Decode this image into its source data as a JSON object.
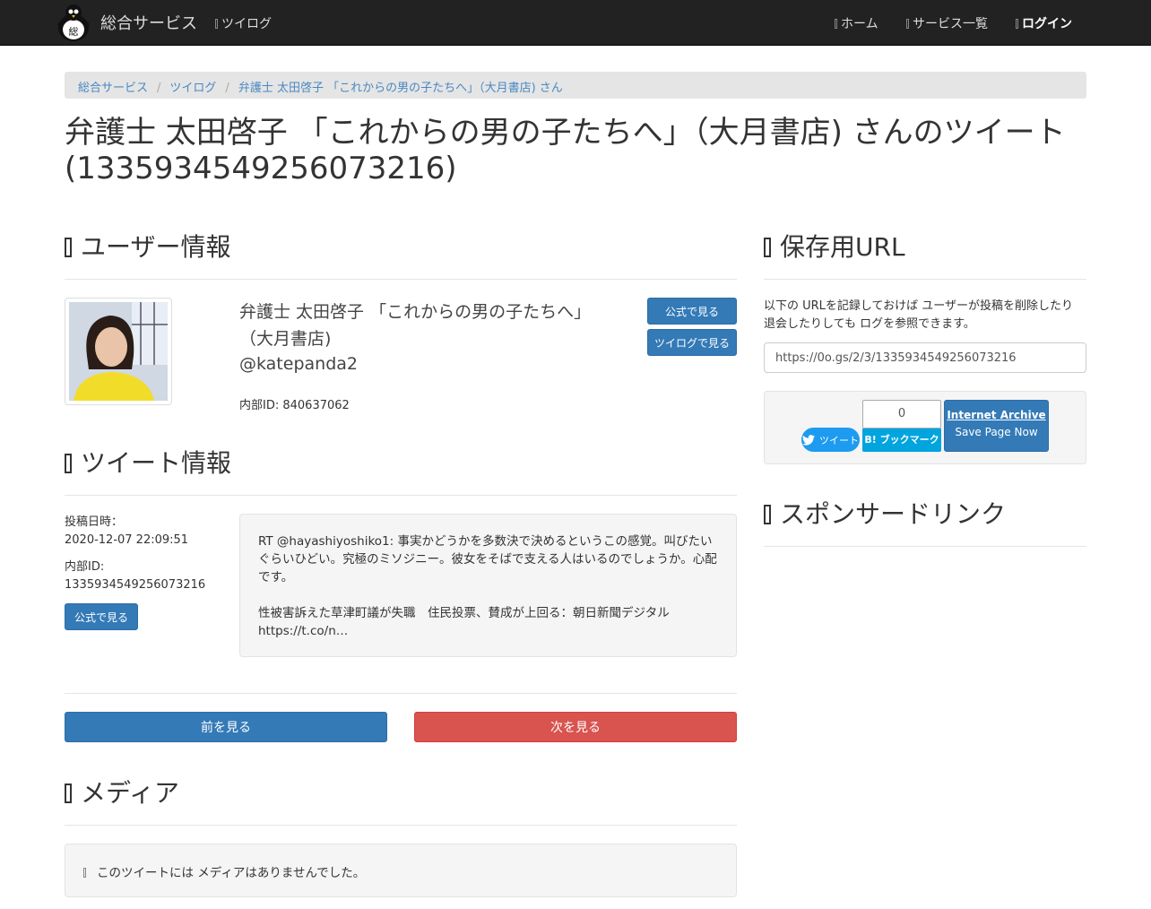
{
  "nav": {
    "brand": "総合サービス",
    "logo_char": "総",
    "left_link": "ツイログ",
    "home": "ホーム",
    "services": "サービス一覧",
    "login": "ログイン"
  },
  "breadcrumb": [
    "総合サービス",
    "ツイログ",
    "弁護士 太田啓子 「これからの男の子たちへ」（大月書店) さん"
  ],
  "page_title": "弁護士 太田啓子 「これからの男の子たちへ」（大月書店) さんのツイート (1335934549256073216)",
  "user_section": {
    "title": "ユーザー情報",
    "display_name": "弁護士 太田啓子 「これからの男の子たちへ」（大月書店)",
    "handle": "@katepanda2",
    "internal_id": "内部ID: 840637062",
    "btn_official": "公式で見る",
    "btn_twilog": "ツイログで見る"
  },
  "tweet_section": {
    "title": "ツイート情報",
    "posted_label": "投稿日時：",
    "posted_value": "2020-12-07 22:09:51",
    "id_label": "内部ID:",
    "id_value": "1335934549256073216",
    "btn_official": "公式で見る",
    "text_line1": "RT @hayashiyoshiko1: 事実かどうかを多数決で決めるというこの感覚。叫びたいぐらいひどい。究極のミソジニー。彼女をそばで支える人はいるのでしょうか。心配です。",
    "text_line2": "性被害訴えた草津町議が失職　住民投票、賛成が上回る：朝日新聞デジタル https://t.co/n…"
  },
  "pager": {
    "prev": "前を見る",
    "next": "次を見る"
  },
  "media_section": {
    "title": "メディア",
    "empty_text": "このツイートには メディアはありませんでした。"
  },
  "save_section": {
    "title": "保存用URL",
    "description": "以下の URLを記録しておけば ユーザーが投稿を削除したり 退会したりしても ログを参照できます。",
    "url": "https://0o.gs/2/3/1335934549256073216",
    "tweet_button": "ツイート",
    "hatena_count": "0",
    "hatena_label": "B! ブックマーク",
    "ia_title": "Internet Archive",
    "ia_sub": "Save Page Now"
  },
  "sponsor_section": {
    "title": "スポンサードリンク"
  },
  "colors": {
    "primary": "#337ab7",
    "danger": "#d9534f",
    "navbar": "#222222",
    "twitter": "#1d9bf0",
    "hatena": "#00a4de"
  }
}
